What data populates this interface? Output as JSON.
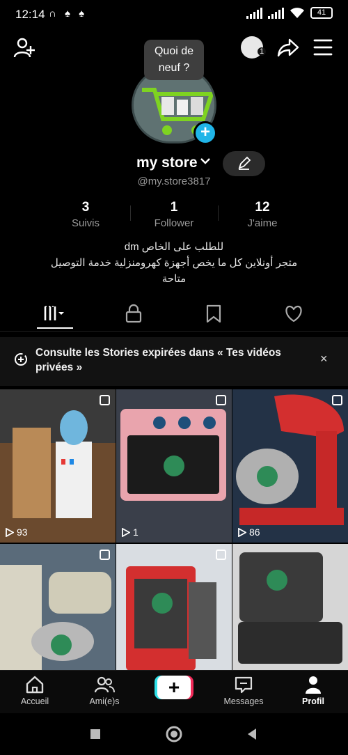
{
  "status_bar": {
    "time": "12:14",
    "left_icons": "∩ ♠ ♠",
    "battery": "41"
  },
  "topbar": {
    "avatar_badge": "1"
  },
  "profile": {
    "tooltip": "Quoi de neuf ?",
    "name": "my store",
    "handle": "@my.store3817",
    "stats": [
      {
        "value": "3",
        "label": "Suivis"
      },
      {
        "value": "1",
        "label": "Follower"
      },
      {
        "value": "12",
        "label": "J'aime"
      }
    ],
    "bio": [
      "للطلب على الخاص dm",
      "متجر أونلاين كل ما يخص أجهزة كهرومنزلية خدمة التوصيل",
      "متاحة"
    ]
  },
  "banner": {
    "text": "Consulte les Stories expirées dans « Tes vidéos privées »",
    "close": "×"
  },
  "grid": [
    {
      "views": "93",
      "multi": true
    },
    {
      "views": "1",
      "multi": true
    },
    {
      "views": "86",
      "multi": true
    },
    {
      "views": "",
      "multi": true
    },
    {
      "views": "",
      "multi": true
    },
    {
      "views": "",
      "multi": false
    }
  ],
  "bottom_nav": {
    "items": [
      {
        "label": "Accueil"
      },
      {
        "label": "Ami(e)s"
      },
      {
        "label": "+"
      },
      {
        "label": "Messages"
      },
      {
        "label": "Profil"
      }
    ]
  },
  "colors": {
    "accent_blue": "#20b5e8",
    "create_left": "#2fe1e9",
    "create_right": "#f22b5a"
  }
}
